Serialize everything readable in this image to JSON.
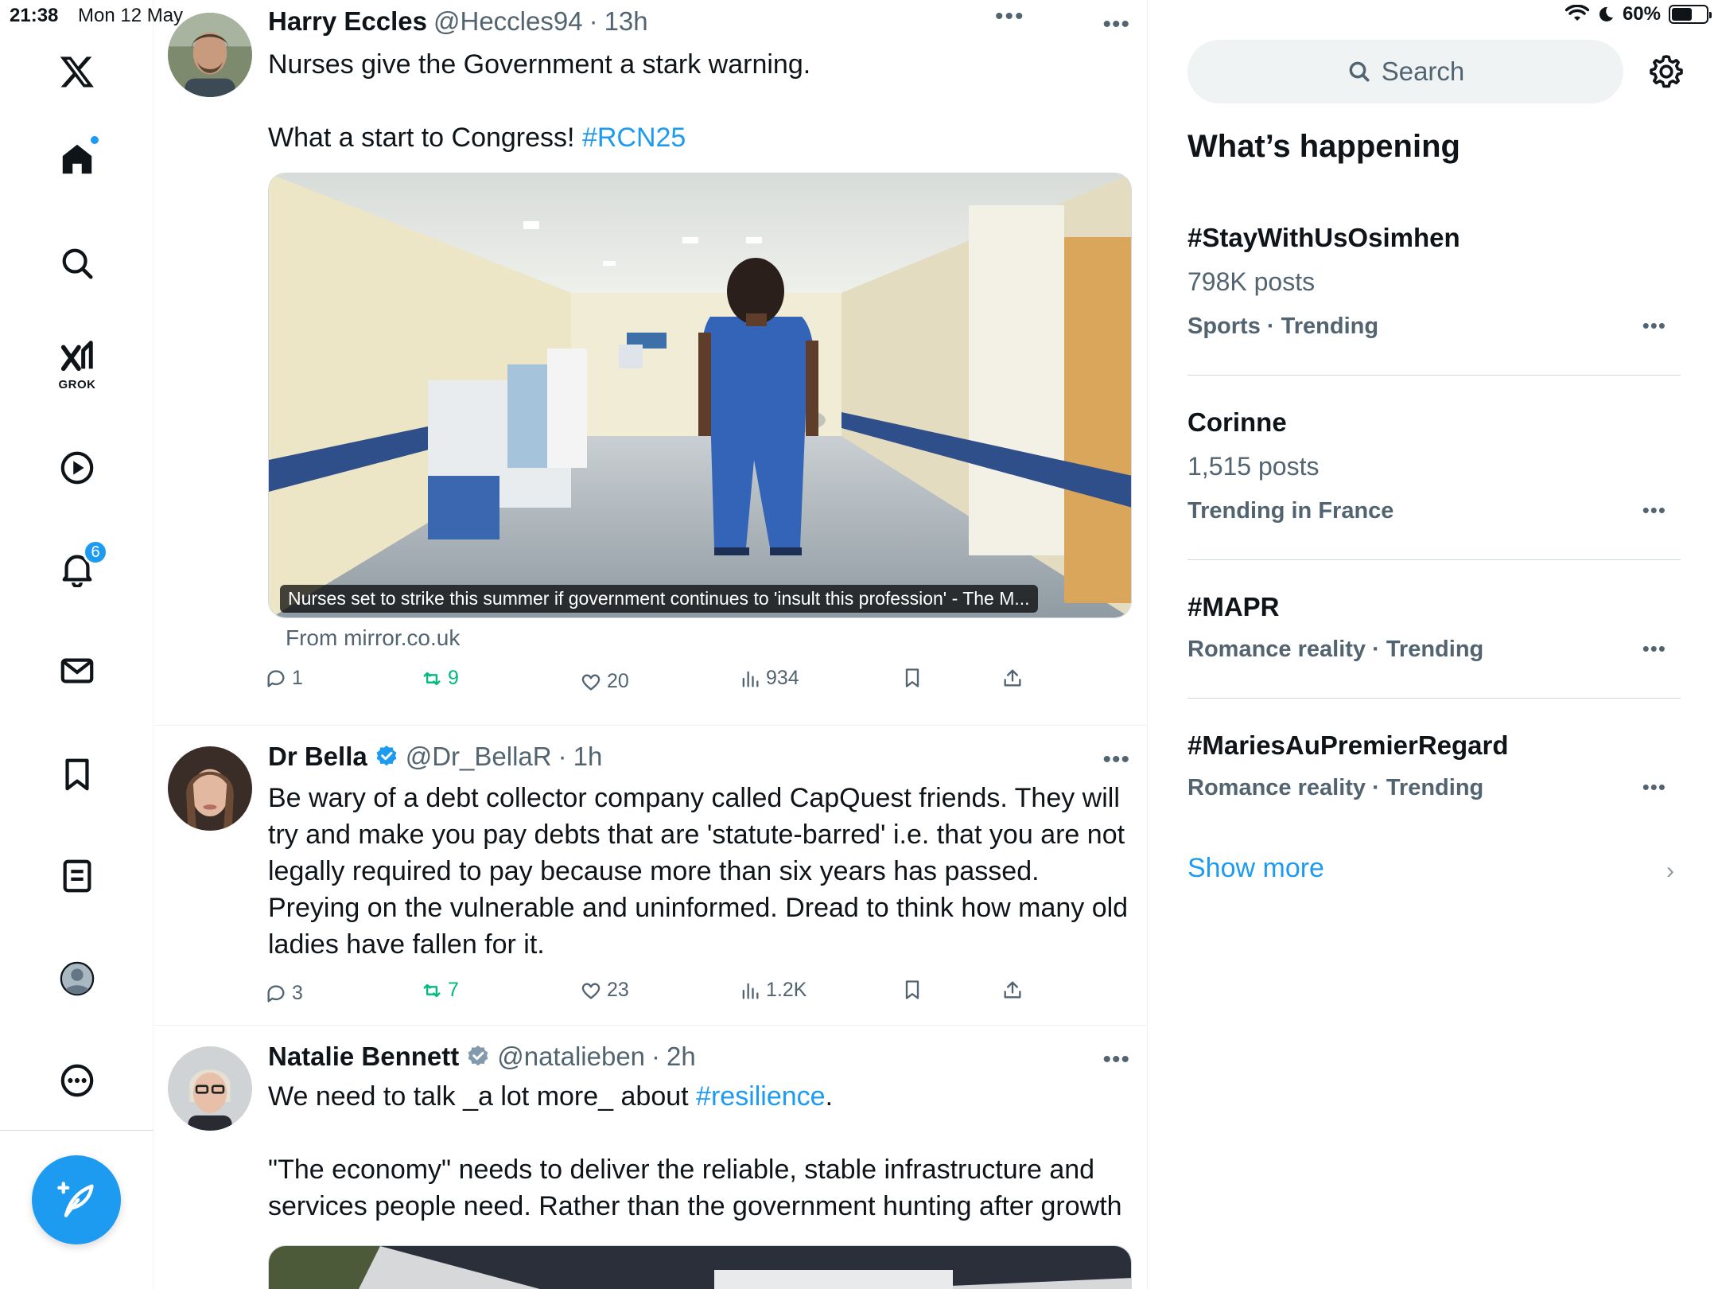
{
  "status_bar": {
    "time": "21:38",
    "date": "Mon 12 May",
    "battery": "60%",
    "battery_level": 0.6
  },
  "nav": {
    "notifications_badge": "6",
    "grok_label": "GROK"
  },
  "feed": {
    "top_dots": "•••",
    "tweets": [
      {
        "name": "Harry Eccles",
        "handle": "@Heccles94",
        "time": "13h",
        "text_line1": "Nurses give the Government a stark warning.",
        "text_line2_prefix": "What a start to Congress! ",
        "text_line2_hashtag": "#RCN25",
        "media_caption": "Nurses set to strike this summer if government continues to 'insult this profession' - The M...",
        "from": "From mirror.co.uk",
        "replies": "1",
        "retweets": "9",
        "likes": "20",
        "views": "934"
      },
      {
        "name": "Dr Bella",
        "handle": "@Dr_BellaR",
        "time": "1h",
        "text": "Be wary of a debt collector company called CapQuest friends. They will try and make you pay debts that are 'statute-barred' i.e. that you are not legally required to pay because more than six years has passed. Preying on the vulnerable and uninformed. Dread to think how many old ladies have fallen for it.",
        "replies": "3",
        "retweets": "7",
        "likes": "23",
        "views": "1.2K"
      },
      {
        "name": "Natalie Bennett",
        "handle": "@natalieben",
        "time": "2h",
        "text_line1_prefix": "We need to talk _a lot more_ about ",
        "text_line1_hashtag": "#resilience",
        "text_line1_suffix": ".",
        "text_line2": "\"The economy\" needs to deliver the reliable, stable infrastructure and services people need. Rather than the government hunting after growth"
      }
    ]
  },
  "right": {
    "search_placeholder": "Search",
    "title": "What’s happening",
    "trends": [
      {
        "name": "#StayWithUsOsimhen",
        "posts": "798K posts",
        "meta": "Sports · Trending"
      },
      {
        "name": "Corinne",
        "posts": "1,515 posts",
        "meta": "Trending in France"
      },
      {
        "name": "#MAPR",
        "meta": "Romance reality · Trending"
      },
      {
        "name": "#MariesAuPremierRegard",
        "meta": "Romance reality · Trending"
      }
    ],
    "show_more": "Show more",
    "more_dots": "•••"
  },
  "colors": {
    "accent": "#1d9bf0",
    "retweet": "#00ba7c",
    "muted": "#536471"
  }
}
